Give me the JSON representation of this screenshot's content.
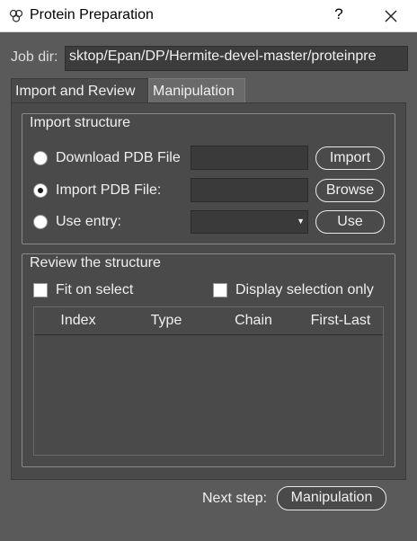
{
  "window": {
    "title": "Protein Preparation",
    "help_label": "?",
    "icon": "protein-icon"
  },
  "job_dir": {
    "label": "Job dir:",
    "value": "sktop/Epan/DP/Hermite-devel-master/proteinpre"
  },
  "tabs": [
    {
      "label": "Import and Review",
      "active": true
    },
    {
      "label": "Manipulation",
      "active": false
    }
  ],
  "import_structure": {
    "title": "Import structure",
    "options": [
      {
        "label": "Download PDB File",
        "checked": false,
        "button": "Import"
      },
      {
        "label": "Import PDB File:",
        "checked": true,
        "button": "Browse"
      },
      {
        "label": "Use entry:",
        "checked": false,
        "button": "Use"
      }
    ]
  },
  "review": {
    "title": "Review the structure",
    "fit_on_select": {
      "label": "Fit on select",
      "checked": false
    },
    "display_selection_only": {
      "label": "Display selection only",
      "checked": false
    },
    "columns": [
      "Index",
      "Type",
      "Chain",
      "First-Last"
    ],
    "rows": []
  },
  "footer": {
    "next_label": "Next step:",
    "next_button": "Manipulation"
  },
  "colors": {
    "background": "#5a5a5a",
    "panel": "#4a4a4a",
    "field": "#3a3a3a",
    "text": "#f0f0f0"
  }
}
